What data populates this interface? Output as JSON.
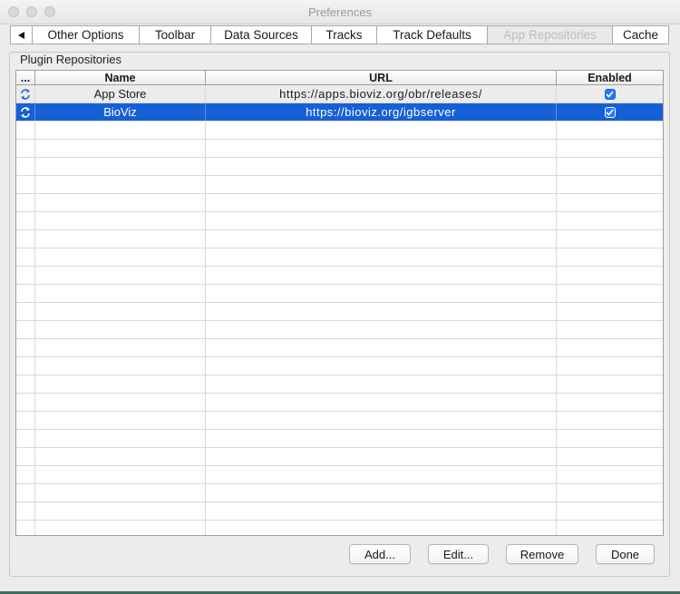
{
  "window": {
    "title": "Preferences"
  },
  "tabs": {
    "scroll_left_icon": "triangle-left-icon",
    "items": [
      {
        "label": "Other Options",
        "enabled": true
      },
      {
        "label": "Toolbar",
        "enabled": true
      },
      {
        "label": "Data Sources",
        "enabled": true
      },
      {
        "label": "Tracks",
        "enabled": true
      },
      {
        "label": "Track Defaults",
        "enabled": true
      },
      {
        "label": "App Repositories",
        "enabled": false
      },
      {
        "label": "Cache",
        "enabled": true
      }
    ]
  },
  "panel": {
    "title": "Plugin Repositories"
  },
  "table": {
    "columns": [
      "...",
      "Name",
      "URL",
      "Enabled"
    ],
    "row_icon": "refresh-arrows-icon",
    "rows": [
      {
        "name": "App Store",
        "url": "https://apps.bioviz.org/obr/releases/",
        "enabled": true,
        "selected": false
      },
      {
        "name": "BioViz",
        "url": "https://bioviz.org/igbserver",
        "enabled": true,
        "selected": true
      }
    ],
    "selection_color": "#1660d6"
  },
  "buttons": {
    "add": "Add...",
    "edit": "Edit...",
    "remove": "Remove",
    "done": "Done"
  }
}
